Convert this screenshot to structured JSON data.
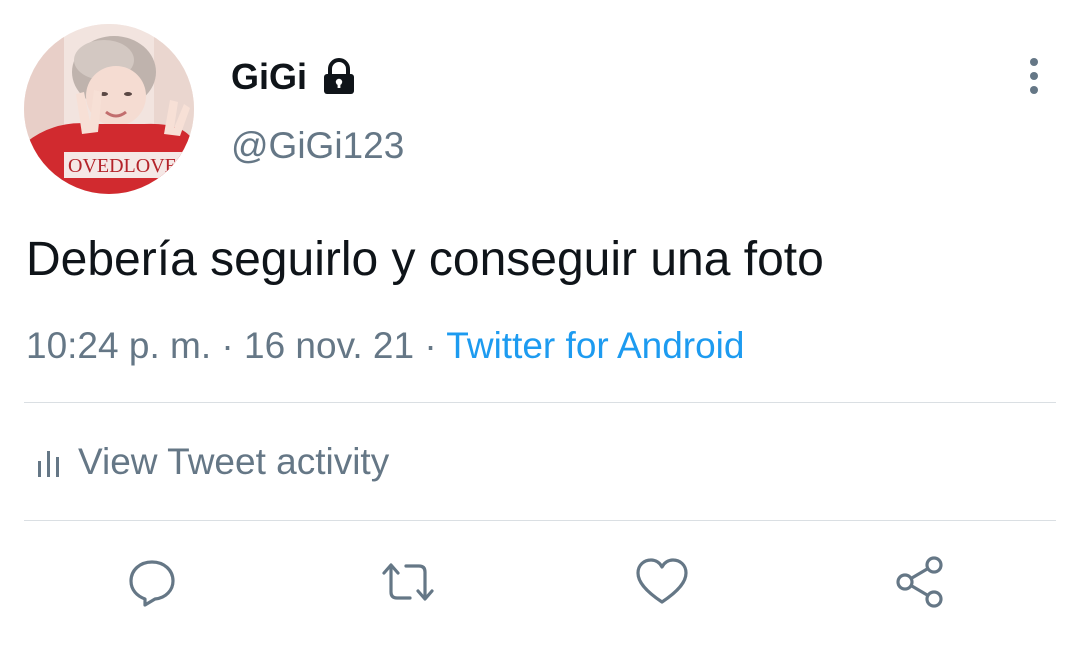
{
  "user": {
    "display_name": "GiGi",
    "handle": "@GiGi123",
    "protected_icon": "lock-icon",
    "avatar_shirt_text": "OVEDLOVE"
  },
  "tweet": {
    "text": "Debería seguirlo y conseguir una foto",
    "time": "10:24 p. m.",
    "separator": "·",
    "date": "16 nov. 21",
    "source": "Twitter for Android"
  },
  "activity": {
    "label": "View Tweet activity",
    "icon": "bar-chart-icon"
  },
  "actions": {
    "reply_icon": "reply-icon",
    "retweet_icon": "retweet-icon",
    "like_icon": "heart-icon",
    "share_icon": "share-icon"
  },
  "colors": {
    "text_primary": "#0f1419",
    "text_secondary": "#657786",
    "link": "#1d9bf0",
    "divider": "#dadfe3"
  }
}
